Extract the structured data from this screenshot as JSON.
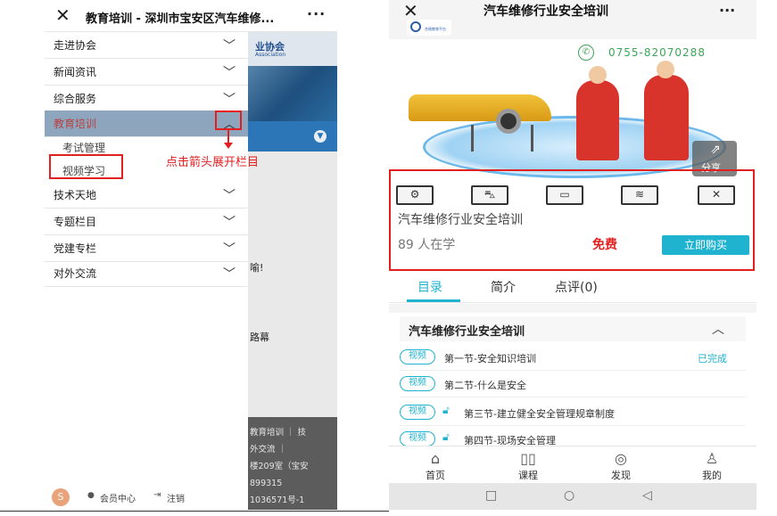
{
  "left": {
    "header": {
      "title": "教育培训 - 深圳市宝安区汽车维修...",
      "close_glyph": "✕",
      "more_glyph": "···"
    },
    "menu": [
      {
        "label": "走进协会"
      },
      {
        "label": "新闻资讯"
      },
      {
        "label": "综合服务"
      },
      {
        "label": "教育培训",
        "expanded": true
      },
      {
        "label": "技术天地"
      },
      {
        "label": "专题栏目"
      },
      {
        "label": "党建专栏"
      },
      {
        "label": "对外交流"
      }
    ],
    "submenu": [
      {
        "label": "考试管理"
      },
      {
        "label": "视频学习"
      }
    ],
    "annotation": "点击箭头展开栏目",
    "background": {
      "logo_text": "业协会",
      "logo_sub": "Association",
      "text_1": "喻!",
      "text_2": "路幕",
      "footer_lines": [
        "教育培训 ｜ 技",
        "外交流 ｜",
        "楼209室（宝安",
        "899315",
        "1036571号-1"
      ]
    },
    "bottom": {
      "avatar": "S",
      "member_label": "会员中心",
      "logout_label": "注销"
    }
  },
  "right": {
    "header": {
      "title": "汽车维修行业安全培训",
      "close_glyph": "✕",
      "more_glyph": "···",
      "logo_text": "合格教育平台"
    },
    "phone": "0755-82070288",
    "share_label": "分享",
    "course": {
      "title": "汽车维修行业安全培训",
      "learners": "89 人在学",
      "price": "免费",
      "buy_label": "立即购买"
    },
    "tabs": [
      {
        "label": "目录"
      },
      {
        "label": "简介"
      },
      {
        "label": "点评(0)"
      }
    ],
    "section_title": "汽车维修行业安全培训",
    "lessons": [
      {
        "badge": "视频",
        "title": "第一节-安全知识培训",
        "status": "已完成",
        "locked": false
      },
      {
        "badge": "视频",
        "title": "第二节-什么是安全",
        "status": "",
        "locked": false
      },
      {
        "badge": "视频",
        "title": "第三节-建立健全安全管理规章制度",
        "status": "",
        "locked": true
      },
      {
        "badge": "视频",
        "title": "第四节-现场安全管理",
        "status": "",
        "locked": true
      }
    ],
    "bottom_nav": [
      {
        "label": "首页",
        "icon": "home-icon"
      },
      {
        "label": "课程",
        "icon": "book-icon"
      },
      {
        "label": "发现",
        "icon": "compass-icon"
      },
      {
        "label": "我的",
        "icon": "user-icon"
      }
    ]
  },
  "colors": {
    "accent": "#1fb3cf",
    "annotation": "#e32020",
    "phone_green": "#3aa655"
  }
}
